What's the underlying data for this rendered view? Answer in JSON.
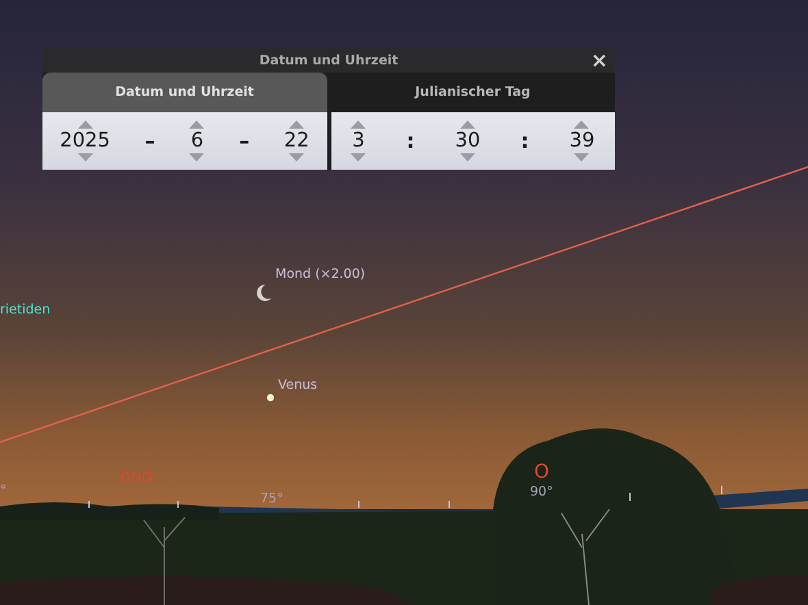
{
  "dialog": {
    "title": "Datum und Uhrzeit",
    "close": "×",
    "tabs": [
      {
        "label": "Datum und Uhrzeit",
        "selected": true
      },
      {
        "label": "Julianischer Tag",
        "selected": false
      }
    ],
    "date_fields": [
      {
        "kind": "spinner",
        "value": "2025"
      },
      {
        "kind": "separator",
        "value": "–"
      },
      {
        "kind": "spinner",
        "value": "6"
      },
      {
        "kind": "separator",
        "value": "–"
      },
      {
        "kind": "spinner",
        "value": "22"
      }
    ],
    "time_fields": [
      {
        "kind": "spinner",
        "value": "3"
      },
      {
        "kind": "separator",
        "value": ":"
      },
      {
        "kind": "spinner",
        "value": "30"
      },
      {
        "kind": "separator",
        "value": ":"
      },
      {
        "kind": "spinner",
        "value": "39"
      }
    ]
  },
  "sky_labels": [
    {
      "kind": "meteor-shower",
      "text": "rietiden"
    },
    {
      "kind": "planet",
      "text": "Mond (×2.00)"
    },
    {
      "kind": "planet",
      "text": "Venus"
    },
    {
      "kind": "azimuth",
      "text": "°"
    },
    {
      "kind": "compass-point",
      "text": "ONO"
    },
    {
      "kind": "azimuth",
      "text": "75°"
    },
    {
      "kind": "compass-point",
      "text": "O"
    },
    {
      "kind": "azimuth",
      "text": "90°"
    }
  ]
}
